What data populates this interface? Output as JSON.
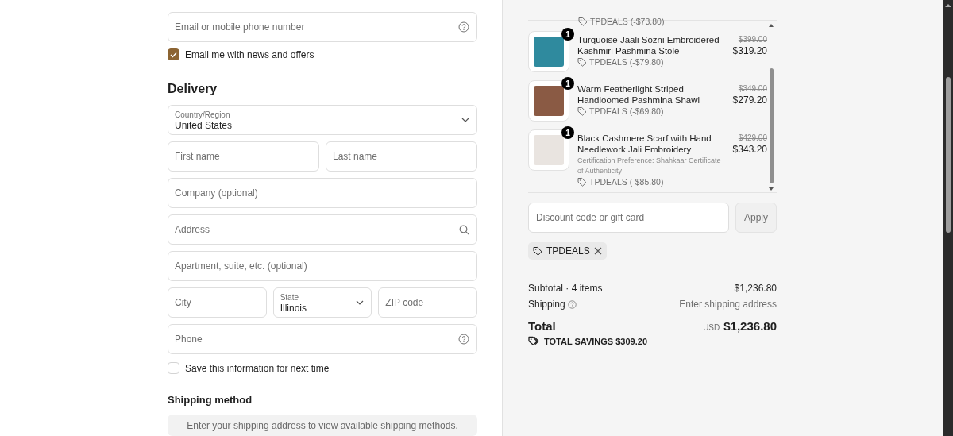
{
  "contact": {
    "email_field": {
      "placeholder": "Email or mobile phone number"
    },
    "news_opt_in": {
      "label": "Email me with news and offers",
      "checked": true
    }
  },
  "delivery": {
    "heading": "Delivery",
    "rows": [
      [
        {
          "kind": "select",
          "label": "Country/Region",
          "value": "United States"
        }
      ],
      [
        {
          "kind": "text",
          "placeholder": "First name"
        },
        {
          "kind": "text",
          "placeholder": "Last name"
        }
      ],
      [
        {
          "kind": "text",
          "placeholder": "Company (optional)"
        }
      ],
      [
        {
          "kind": "search",
          "placeholder": "Address"
        }
      ],
      [
        {
          "kind": "text",
          "placeholder": "Apartment, suite, etc. (optional)"
        }
      ],
      [
        {
          "kind": "text",
          "placeholder": "City"
        },
        {
          "kind": "select",
          "label": "State",
          "value": "Illinois"
        },
        {
          "kind": "text",
          "placeholder": "ZIP code"
        }
      ],
      [
        {
          "kind": "help",
          "placeholder": "Phone"
        }
      ]
    ],
    "save_info": {
      "label": "Save this information for next time",
      "checked": false
    }
  },
  "shipping_method": {
    "heading": "Shipping method",
    "notice": "Enter your shipping address to view available shipping methods."
  },
  "order": {
    "previous_item_discount": "TPDEALS (-$73.80)",
    "items": [
      {
        "quantity": "1",
        "name": "Turquoise Jaali Sozni Embroidered Kashmiri Pashmina Stole",
        "original_price": "$399.00",
        "price": "$319.20",
        "discount": "TPDEALS (-$79.80)"
      },
      {
        "quantity": "1",
        "name": "Warm Featherlight Striped Handloomed Pashmina Shawl",
        "original_price": "$349.00",
        "price": "$279.20",
        "discount": "TPDEALS (-$69.80)"
      },
      {
        "quantity": "1",
        "name": "Black Cashmere Scarf with Hand Needlework Jali Embroidery",
        "original_price": "$429.00",
        "price": "$343.20",
        "detail": "Certification Preference: Shahkaar Certificate of Authenticity",
        "discount": "TPDEALS (-$85.80)"
      }
    ]
  },
  "discount": {
    "placeholder": "Discount code or gift card",
    "apply_button": {
      "label": "Apply",
      "disabled": true
    },
    "applied_code": "TPDEALS"
  },
  "summary": {
    "subtotal_label": "Subtotal · 4 items",
    "subtotal": "$1,236.80",
    "shipping_label": "Shipping",
    "shipping_value": "Enter shipping address",
    "total_label": "Total",
    "currency": "USD",
    "total": "$1,236.80",
    "savings": "TOTAL SAVINGS $309.20"
  }
}
